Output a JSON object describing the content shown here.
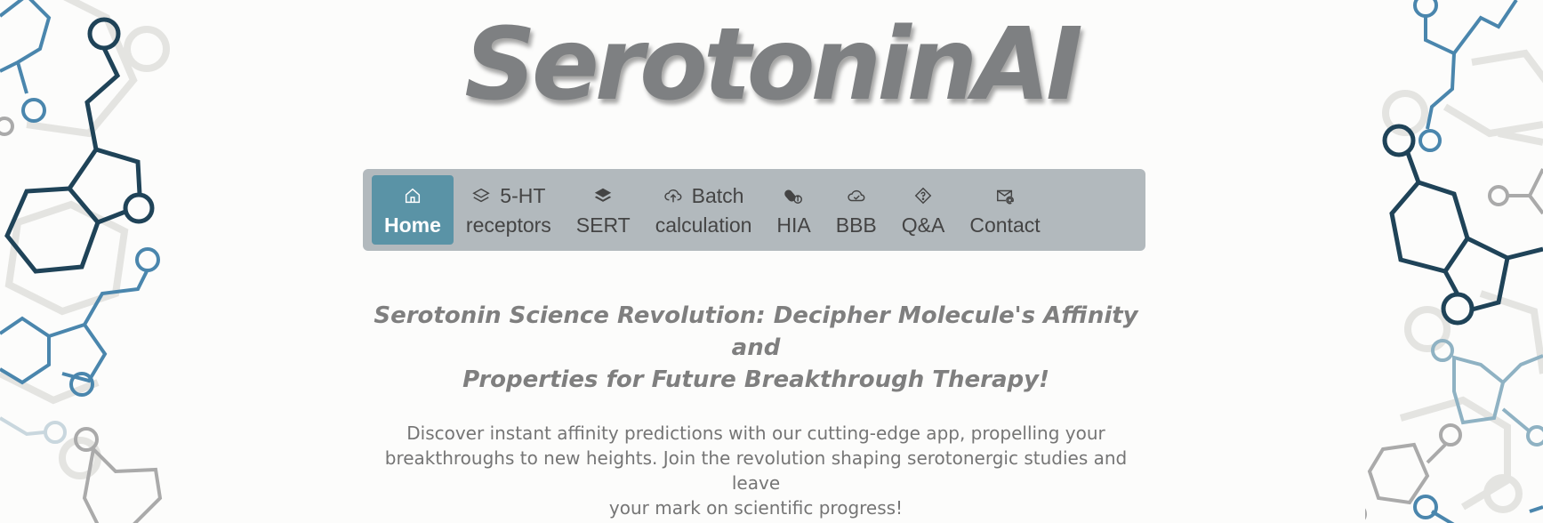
{
  "logo": {
    "text": "SerotoninAI"
  },
  "nav": {
    "items": [
      {
        "icon": "home-icon",
        "line1": "",
        "line2": "Home",
        "active": true
      },
      {
        "icon": "layers-icon",
        "line1": "5-HT",
        "line2": "receptors",
        "active": false
      },
      {
        "icon": "stack-icon",
        "line1": "",
        "line2": "SERT",
        "active": false
      },
      {
        "icon": "cloud-upload-icon",
        "line1": "Batch",
        "line2": "calculation",
        "active": false
      },
      {
        "icon": "capsule-info-icon",
        "line1": "",
        "line2": "HIA",
        "active": false
      },
      {
        "icon": "cloud-check-icon",
        "line1": "",
        "line2": "BBB",
        "active": false
      },
      {
        "icon": "question-diamond-icon",
        "line1": "",
        "line2": "Q&A",
        "active": false
      },
      {
        "icon": "envelope-at-icon",
        "line1": "",
        "line2": "Contact",
        "active": false
      }
    ]
  },
  "main": {
    "headline_line1": "Serotonin Science Revolution: Decipher Molecule's Affinity and",
    "headline_line2": "Properties for Future Breakthrough Therapy!",
    "intro_line1": "Discover instant affinity predictions with our cutting-edge app, propelling your",
    "intro_line2": "breakthroughs to new heights. Join the revolution shaping serotonergic studies and leave",
    "intro_line3": "your mark on scientific progress!"
  },
  "colors": {
    "nav_bg": "#b2b9bd",
    "nav_active": "#5a93a6",
    "molecule_dark": "#1f4358",
    "molecule_blue": "#4a86ad",
    "molecule_gray": "#e2e2df"
  }
}
